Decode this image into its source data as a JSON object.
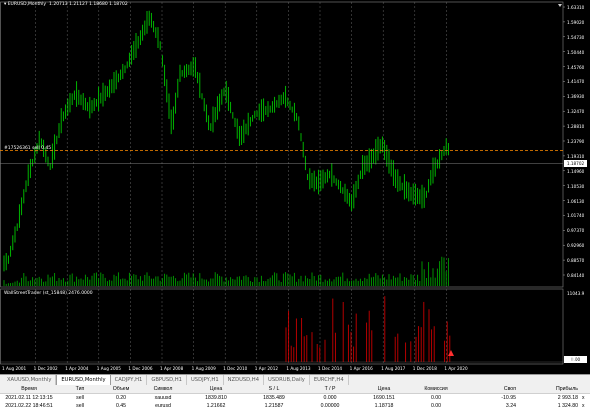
{
  "chart": {
    "title": "EURUSD,Monthly",
    "ohlc": "1.20713 1.21127 1.18680 1.18702",
    "trade_label": "#17526361 sell 0.45",
    "price_tag": "1.18702",
    "indicator_title": "WallStreetTrader (st_15848) 2476.0000",
    "indicator_tag": "0.00",
    "price_axis": [
      "1.63310",
      "1.59020",
      "1.54730",
      "1.50440",
      "1.45760",
      "1.41470",
      "1.36930",
      "1.32470",
      "1.28810",
      "1.23790",
      "1.19310",
      "1.14960",
      "1.10530",
      "1.06130",
      "1.01740",
      "0.97370",
      "0.92960",
      "0.88570",
      "0.84140"
    ],
    "indicator_axis": [
      "11043.9",
      "0.00"
    ],
    "time_axis": [
      "1 Aug 2001",
      "1 Dec 2002",
      "1 Apr 2004",
      "1 Aug 2005",
      "1 Dec 2006",
      "1 Apr 2008",
      "1 Aug 2009",
      "1 Dec 2010",
      "1 Apr 2012",
      "1 Aug 2013",
      "1 Dec 2014",
      "1 Apr 2016",
      "1 Aug 2017",
      "1 Dec 2018",
      "1 Apr 2020"
    ],
    "colors": {
      "candles": "#00c800",
      "volume": "#00a000",
      "hist": "#c80000",
      "trade_line": "#ff8c00",
      "grid": "#646464",
      "price_line": "#808080"
    }
  },
  "tabs": [
    {
      "label": "XAUUSD,Monthly",
      "active": false
    },
    {
      "label": "EURUSD,Monthly",
      "active": true
    },
    {
      "label": "CADJPY,H1",
      "active": false
    },
    {
      "label": "GBPUSD,H1",
      "active": false
    },
    {
      "label": "USDJPY,H1",
      "active": false
    },
    {
      "label": "NZDUSD,H4",
      "active": false
    },
    {
      "label": "USDRUB,Daily",
      "active": false
    },
    {
      "label": "EURCHF,H4",
      "active": false
    }
  ],
  "table": {
    "headers": {
      "time": "Время",
      "type": "Тип",
      "volume": "Объем",
      "symbol": "Символ",
      "price": "Цена",
      "sl": "S / L",
      "tp": "T / P",
      "current": "Цена",
      "commission": "Комиссия",
      "swap": "Своп",
      "profit": "Прибыль"
    },
    "rows": [
      {
        "time": "2021.02.11 12:13:15",
        "type": "sell",
        "volume": "0.20",
        "symbol": "xauusd",
        "price": "1839.810",
        "sl": "1835.489",
        "tp": "0.000",
        "current": "1690.151",
        "commission": "0.00",
        "swap": "-10.95",
        "profit": "2 993.18",
        "close": "x"
      },
      {
        "time": "2021.02.22 18:46:51",
        "type": "sell",
        "volume": "0.45",
        "symbol": "eurusd",
        "price": "1.21662",
        "sl": "1.21587",
        "tp": "0.00000",
        "current": "1.18718",
        "commission": "0.00",
        "swap": "3.24",
        "profit": "1 324.80",
        "close": "x"
      }
    ]
  }
}
